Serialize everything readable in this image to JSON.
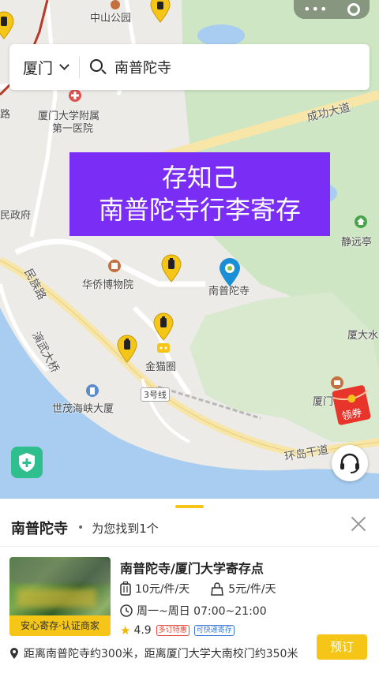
{
  "map": {
    "labels": {
      "zhongshan_park": "中山公园",
      "hospital": "厦门大学附属",
      "hospital2": "第一医院",
      "gov": "民政府",
      "museum": "华侨博物院",
      "nanputuo": "南普陀寺",
      "jinmao": "金猫圈",
      "shimao": "世茂海峡大厦",
      "jingyuan": "静远亭",
      "xiada_water": "厦大水",
      "xiamen_partial": "厦门",
      "chenggong": "成功大道",
      "huandao": "环岛干道",
      "minzu": "民族路",
      "yanwu": "演武大桥",
      "line3": "3号线",
      "lu": "路"
    },
    "banner": {
      "line1": "存知己",
      "line2": "南普陀寺行李寄存"
    },
    "coupon_label": "领券"
  },
  "search": {
    "city": "厦门",
    "query": "南普陀寺"
  },
  "results": {
    "title": "南普陀寺",
    "count_text": "为您找到1个"
  },
  "store": {
    "name": "南普陀寺/厦门大学寄存点",
    "badge": "安心寄存·认证商家",
    "price_large": "10元/件/天",
    "price_small": "5元/件/天",
    "hours": "周一~周日 07:00~21:00",
    "rating": "4.9",
    "tag1": "多订特惠",
    "tag2": "可快递寄存",
    "distance": "距离南普陀寺约300米，距离厦门大学大南校门约350米",
    "book_label": "预订"
  },
  "colors": {
    "accent": "#f5c518",
    "banner": "#7a2ef5",
    "sea": "#a8cdf0",
    "park": "#cde6c2"
  }
}
